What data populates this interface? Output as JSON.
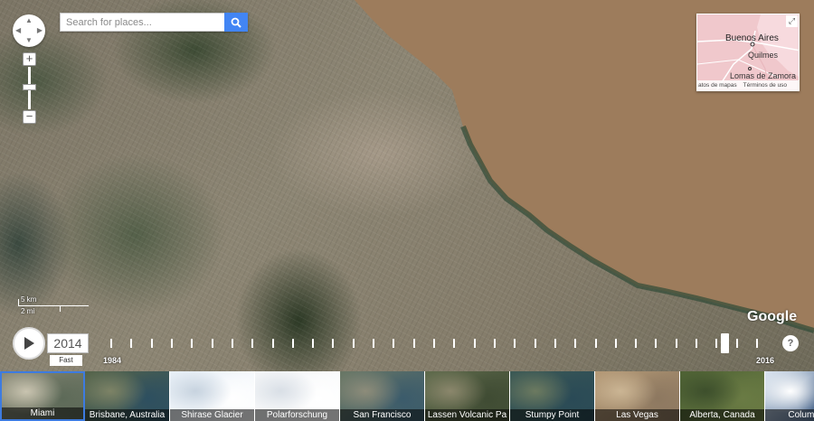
{
  "search": {
    "placeholder": "Search for places...",
    "button_icon": "search-icon"
  },
  "navigation": {
    "pan_icon": "pan-arrows-icon",
    "zoom_in_label": "+",
    "zoom_out_label": "−"
  },
  "inset_map": {
    "places": {
      "city": "Buenos Aires",
      "town1": "Quilmes",
      "town2": "Lomas de Zamora"
    },
    "footer_data": "atos de mapas",
    "footer_terms": "Términos de uso",
    "expand_icon": "expand-icon"
  },
  "scale": {
    "km": "5 km",
    "mi": "2 mi"
  },
  "logo": "Google",
  "timeline": {
    "current_year": "2014",
    "speed_label": "Fast",
    "start_year": "1984",
    "end_year": "2016",
    "progress": 0.94,
    "tick_count": 33,
    "help_label": "?"
  },
  "colors": {
    "water": "#9d7c5c",
    "inset_bg": "#f0c8cc",
    "accent": "#4285f4",
    "selected_border": "#3d7be0"
  },
  "thumbnails": [
    {
      "label": "Miami",
      "selected": true,
      "colors": [
        "#8a8a78",
        "#5d6a58",
        "#c9c4b0"
      ]
    },
    {
      "label": "Brisbane, Australia",
      "selected": false,
      "colors": [
        "#56654a",
        "#2d4f60",
        "#7d8366"
      ]
    },
    {
      "label": "Shirase Glacier",
      "selected": false,
      "colors": [
        "#e6eef6",
        "#ffffff",
        "#c7d3df"
      ]
    },
    {
      "label": "Polarforschung",
      "selected": false,
      "colors": [
        "#f2f4f6",
        "#ffffff",
        "#d9dfe6"
      ]
    },
    {
      "label": "San Francisco",
      "selected": false,
      "colors": [
        "#6a7866",
        "#3b5b6b",
        "#8d8c7a"
      ]
    },
    {
      "label": "Lassen Volcanic Pa",
      "selected": false,
      "colors": [
        "#5f6b4c",
        "#3f4b33",
        "#8b876c"
      ]
    },
    {
      "label": "Stumpy Point",
      "selected": false,
      "colors": [
        "#3d5a55",
        "#2a4a56",
        "#6c7a60"
      ]
    },
    {
      "label": "Las Vegas",
      "selected": false,
      "colors": [
        "#b59a77",
        "#8d7860",
        "#cbb594"
      ]
    },
    {
      "label": "Alberta, Canada",
      "selected": false,
      "colors": [
        "#4e6234",
        "#6a7b44",
        "#3d4f2c"
      ]
    },
    {
      "label": "Columbia",
      "selected": false,
      "colors": [
        "#dbe5f0",
        "#2f4f7a",
        "#ffffff"
      ]
    }
  ]
}
